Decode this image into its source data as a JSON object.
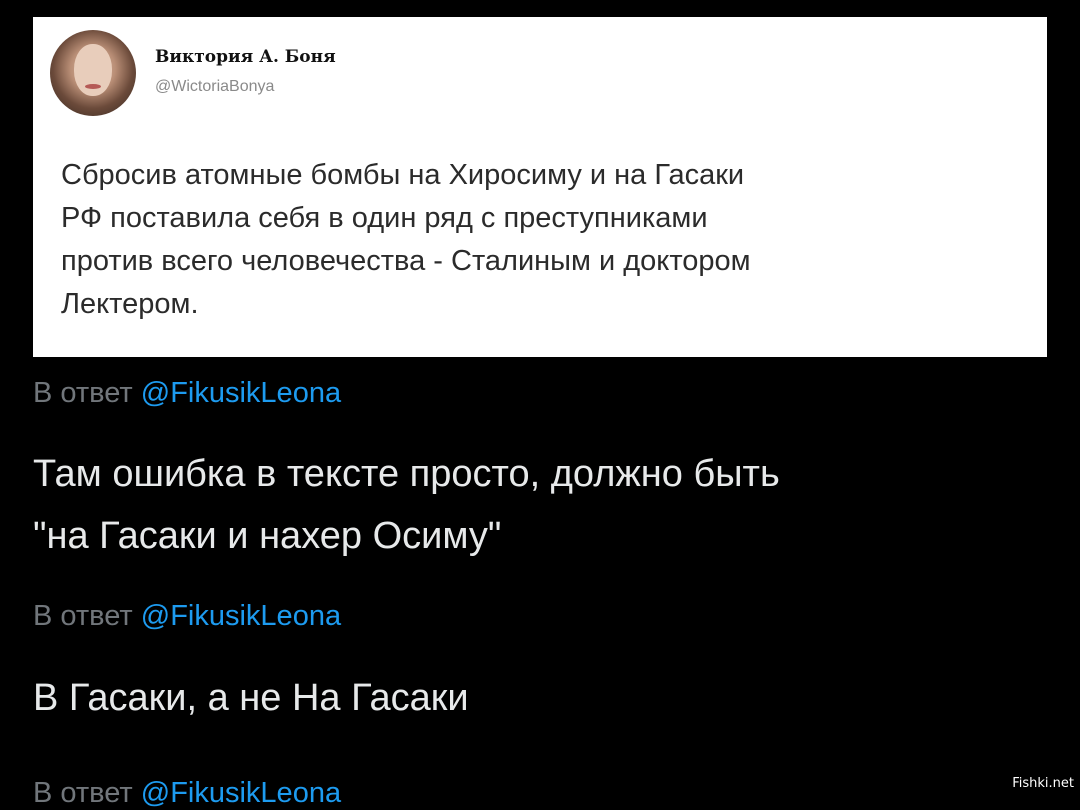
{
  "tweet": {
    "author_name": "Виктория А. Боня",
    "author_handle": "@WictoriaBonya",
    "text_lines": [
      "Сбросив атомные бомбы на Хиросиму и на Гасаки",
      "РФ поставила себя в один ряд с преступниками",
      "против всего человечества - Сталиным и доктором",
      "Лектером."
    ]
  },
  "replies": [
    {
      "reply_prefix": "В ответ",
      "reply_mention": "@FikusikLeona",
      "text_lines": [
        "Там ошибка в тексте просто, должно быть",
        "\"на Гасаки и нахер Осиму\""
      ]
    },
    {
      "reply_prefix": "В ответ",
      "reply_mention": "@FikusikLeona",
      "text_lines": [
        "В Гасаки, а не На Гасаки"
      ]
    },
    {
      "reply_prefix": "В ответ",
      "reply_mention": "@FikusikLeona",
      "text_lines": []
    }
  ],
  "watermark": "Fishki.net",
  "colors": {
    "background": "#000000",
    "mention": "#1d9bf0",
    "muted": "#71767b",
    "text": "#e7e9ea"
  }
}
